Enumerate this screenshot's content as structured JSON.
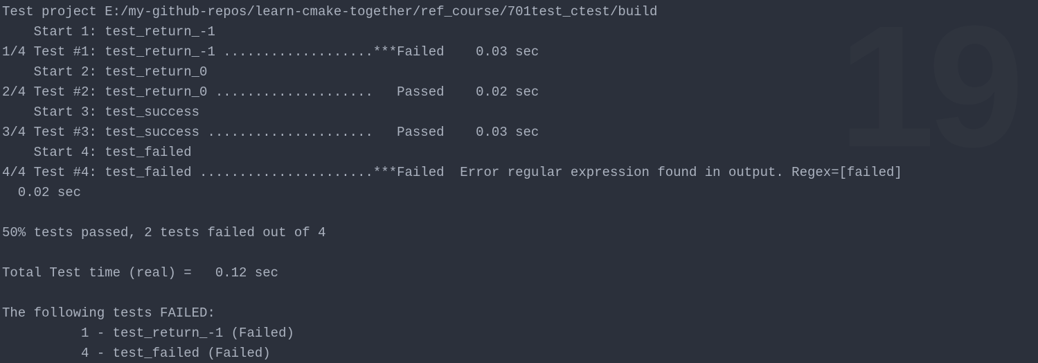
{
  "header": "Test project E:/my-github-repos/learn-cmake-together/ref_course/701test_ctest/build",
  "tests": [
    {
      "start": "    Start 1: test_return_-1",
      "result": "1/4 Test #1: test_return_-1 ...................***Failed    0.03 sec"
    },
    {
      "start": "    Start 2: test_return_0",
      "result": "2/4 Test #2: test_return_0 ....................   Passed    0.02 sec"
    },
    {
      "start": "    Start 3: test_success",
      "result": "3/4 Test #3: test_success .....................   Passed    0.03 sec"
    },
    {
      "start": "    Start 4: test_failed",
      "result": "4/4 Test #4: test_failed ......................***Failed  Error regular expression found in output. Regex=[failed]\n  0.02 sec"
    }
  ],
  "blank1": "",
  "summary": "50% tests passed, 2 tests failed out of 4",
  "blank2": "",
  "total_time": "Total Test time (real) =   0.12 sec",
  "blank3": "",
  "failed_header": "The following tests FAILED:",
  "failed_list": [
    "          1 - test_return_-1 (Failed)",
    "          4 - test_failed (Failed)"
  ],
  "watermark": "19"
}
